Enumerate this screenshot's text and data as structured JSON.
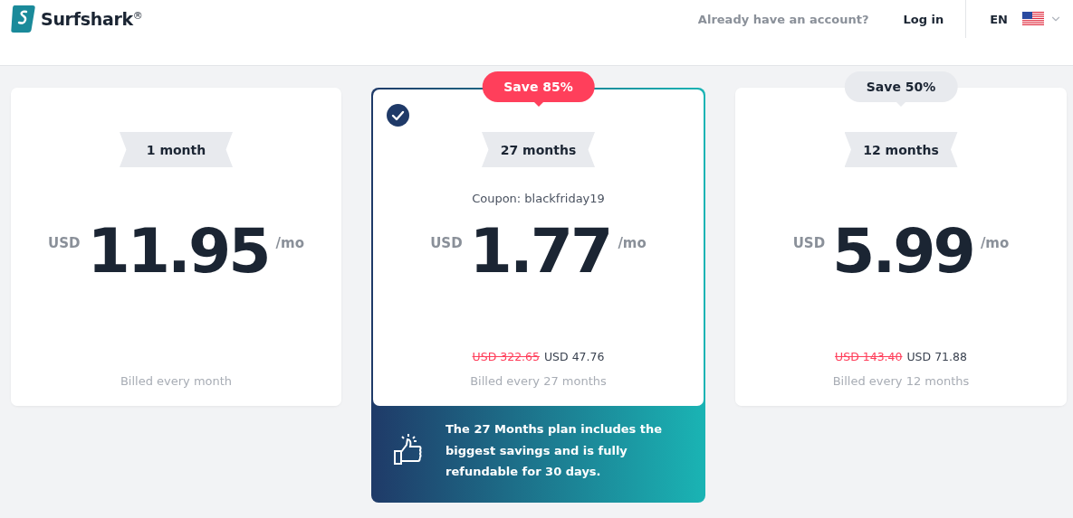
{
  "header": {
    "logo_text": "Surfshark$^{®}$",
    "account_prompt": "Already have an account?",
    "login": "Log in",
    "language": "EN"
  },
  "plans": [
    {
      "selected": false,
      "duration": "1 month",
      "currency": "USD",
      "price": "11.95",
      "unit": "/mo",
      "billing": "Billed every month"
    },
    {
      "selected": true,
      "badge": {
        "text": "Save 85%",
        "kind": "accent"
      },
      "duration": "27 months",
      "coupon": "Coupon: blackfriday19",
      "currency": "USD",
      "price": "1.77",
      "unit": "/mo",
      "old_total": "USD 322.65",
      "total": "USD 47.76",
      "billing": "Billed every 27 months",
      "promo": "The 27 Months plan includes the biggest savings and is fully refundable for 30 days."
    },
    {
      "selected": false,
      "badge": {
        "text": "Save 50%",
        "kind": "plain"
      },
      "duration": "12 months",
      "currency": "USD",
      "price": "5.99",
      "unit": "/mo",
      "old_total": "USD 143.40",
      "total": "USD 71.88",
      "billing": "Billed every 12 months"
    }
  ]
}
